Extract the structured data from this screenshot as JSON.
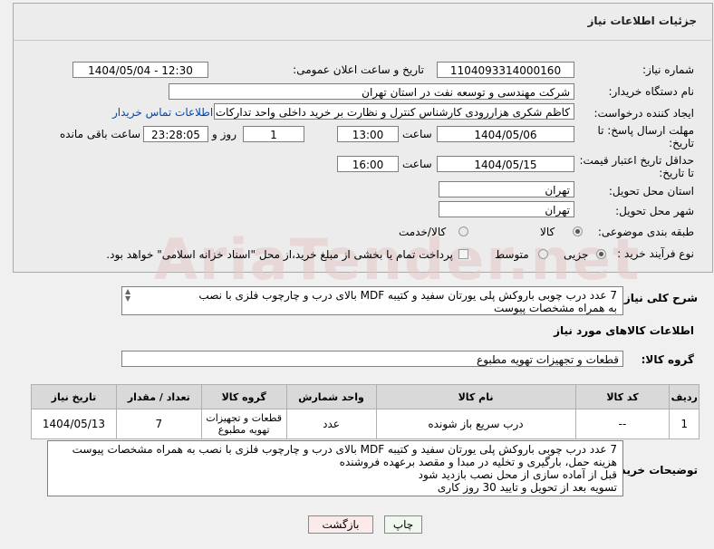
{
  "title": "جزئیات اطلاعات نیاز",
  "fields": {
    "need_number_label": "شماره نیاز:",
    "need_number": "1104093314000160",
    "announce_label": "تاریخ و ساعت اعلان عمومی:",
    "announce_value": "1404/05/04 - 12:30",
    "buyer_org_label": "نام دستگاه خریدار:",
    "buyer_org": "شرکت مهندسی و توسعه نفت در استان تهران",
    "creator_label": "ایجاد کننده درخواست:",
    "creator": "کاظم شکری هزاررودی کارشناس کنترل و نظارت بر خرید داخلی واحد تدارکات و م",
    "contact_link": "اطلاعات تماس خریدار",
    "deadline_label_1": "مهلت ارسال پاسخ: تا",
    "deadline_label_2": "تاریخ:",
    "deadline_date": "1404/05/06",
    "time_label": "ساعت",
    "deadline_time": "13:00",
    "days_value": "1",
    "days_label": "روز و",
    "remaining_time": "23:28:05",
    "remaining_label": "ساعت باقی مانده",
    "validity_label_1": "حداقل تاریخ اعتبار قیمت:",
    "validity_label_2": "تا تاریخ:",
    "validity_date": "1404/05/15",
    "validity_time": "16:00",
    "province_label": "استان محل تحویل:",
    "province": "تهران",
    "city_label": "شهر محل تحویل:",
    "city": "تهران",
    "category_label": "طبقه بندی موضوعی:",
    "cat_goods": "کالا",
    "cat_goods_service": "کالا/خدمت",
    "process_label": "نوع فرآیند خرید :",
    "proc_partial": "جزیی",
    "proc_medium": "متوسط",
    "payment_note": "پرداخت تمام یا بخشی از مبلغ خرید،از محل \"اسناد خزانه اسلامی\" خواهد بود.",
    "summary_label": "شرح کلی نیاز:",
    "summary_line1": "7 عدد درب چوبی باروکش پلی یورتان سفید و کتیبه MDF  بالای درب و چارچوب فلزی با نصب",
    "summary_line2": "به همراه مشخصات پیوست",
    "goods_info_title": "اطلاعات کالاهای مورد نیاز",
    "goods_group_label": "گروه کالا:",
    "goods_group": "قطعات و تجهیزات تهویه مطبوع"
  },
  "table": {
    "headers": [
      "ردیف",
      "کد کالا",
      "نام کالا",
      "واحد شمارش",
      "گروه کالا",
      "تعداد / مقدار",
      "تاریخ نیاز"
    ],
    "row": {
      "index": "1",
      "code": "--",
      "name": "درب سریع باز شونده",
      "unit": "عدد",
      "group_line1": "قطعات و تجهیزات",
      "group_line2": "تهویه مطبوع",
      "qty": "7",
      "date": "1404/05/13"
    }
  },
  "buyer_notes": {
    "label": "توضیحات خریدار:",
    "line1": "7 عدد درب چوبی باروکش پلی یورتان سفید و کتیبه MDF  بالای درب و چارچوب فلزی با نصب به همراه مشخصات پیوست",
    "line2": "هزینه حمل، بارگیری و تخلیه در مبدا و مقصد برعهده فروشنده",
    "line3": "قبل از آماده سازی از محل نصب بازدید شود",
    "line4": "تسویه بعد از تحویل و تایید 30 روز کاری"
  },
  "buttons": {
    "print": "چاپ",
    "back": "بازگشت"
  },
  "watermark": "AriaTender.net"
}
